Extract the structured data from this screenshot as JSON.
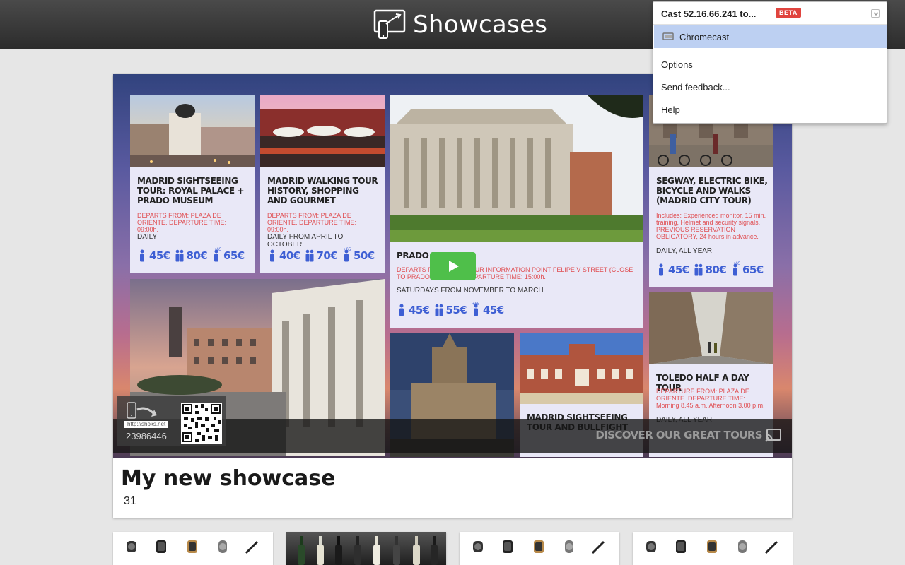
{
  "header": {
    "title": "Showcases"
  },
  "cast_menu": {
    "title": "Cast 52.16.66.241 to...",
    "badge": "BETA",
    "device": "Chromecast",
    "items": [
      "Options",
      "Send feedback...",
      "Help"
    ]
  },
  "showcase": {
    "title": "My new showcase",
    "count": "31",
    "discover_text": "DISCOVER OUR GREAT TOURS",
    "url": "http://shoks.net",
    "code": "23986446",
    "tours": [
      {
        "title": "MADRID SIGHTSEEING TOUR: ROYAL PALACE + PRADO MUSEUM",
        "info": "DEPARTS FROM: PLAZA DE ORIENTE. DEPARTURE TIME: 09:00h.",
        "days": "DAILY",
        "prices": [
          "45€",
          "80€",
          "65€"
        ]
      },
      {
        "title": "MADRID WALKING TOUR HISTORY, SHOPPING AND GOURMET",
        "info": "DEPARTS FROM: PLAZA DE ORIENTE. DEPARTURE TIME: 09:00h.",
        "days": "DAILY FROM APRIL TO OCTOBER",
        "prices": [
          "40€",
          "70€",
          "50€"
        ]
      },
      {
        "title": "PRADO MUSEUM",
        "info": "DEPARTS FROM: CITY TOUR INFORMATION POINT FELIPE V STREET (CLOSE TO PRADO MUSEUM). DEPARTURE TIME: 15:00h.",
        "days": "SATURDAYS FROM NOVEMBER TO MARCH",
        "prices": [
          "45€",
          "55€",
          "45€"
        ]
      },
      {
        "title": "SEGWAY, ELECTRIC BIKE, BICYCLE AND WALKS (MADRID CITY TOUR)",
        "info": "Includes: Experienced monitor, 15 min. training, Helmet and security signals. PREVIOUS RESERVATION OBLIGATORY, 24 hours in advance.",
        "days": "DAILY, ALL YEAR",
        "prices": [
          "45€",
          "80€",
          "65€"
        ]
      },
      {
        "title": "TOLEDO HALF A DAY TOUR",
        "info": "DEPARTURE FROM: PLAZA DE ORIENTE. DEPARTURE TIME: Morning 8.45 a.m. Afternoon 3.00 p.m.",
        "days": "DAILY, ALL YEAR",
        "prices": []
      },
      {
        "title": "MADRID SIGHTSEEING TOUR AND BULLFIGHT",
        "info": "",
        "days": "",
        "prices": []
      }
    ],
    "senior_badge": "+65"
  },
  "colors": {
    "accent_price": "#3e5fd4",
    "info_red": "#e04e52",
    "play_green": "#4fbf4a",
    "beta_red": "#e0443e"
  }
}
